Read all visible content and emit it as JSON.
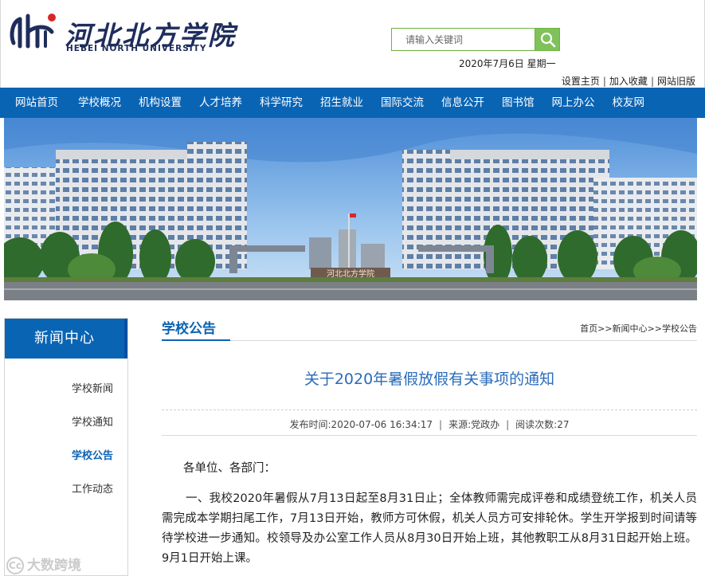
{
  "header": {
    "logo_cn": "河北北方学院",
    "logo_en": "HEBEI NORTH UNIVERSITY",
    "search": {
      "placeholder": "请输入关键词"
    },
    "date": "2020年7月6日 星期一",
    "top_links": [
      "设置主页",
      "加入收藏",
      "网站旧版"
    ]
  },
  "nav": {
    "items": [
      "网站首页",
      "学校概况",
      "机构设置",
      "人才培养",
      "科学研究",
      "招生就业",
      "国际交流",
      "信息公开",
      "图书馆",
      "网上办公",
      "校友网"
    ]
  },
  "banner": {
    "gate_text": "河北北方学院"
  },
  "sidebar": {
    "title": "新闻中心",
    "items": [
      {
        "label": "学校新闻",
        "active": false
      },
      {
        "label": "学校通知",
        "active": false
      },
      {
        "label": "学校公告",
        "active": true
      },
      {
        "label": "工作动态",
        "active": false
      }
    ]
  },
  "main": {
    "section_title": "学校公告",
    "breadcrumb": [
      "首页",
      "新闻中心",
      "学校公告"
    ],
    "breadcrumb_sep": ">>",
    "article_title": "关于2020年暑假放假有关事项的通知",
    "meta": {
      "publish_time": "发布时间:2020-07-06 16:34:17",
      "source": "来源:党政办",
      "views": "阅读次数:27"
    },
    "greeting": "各单位、各部门：",
    "paragraph": "一、我校2020年暑假从7月13日起至8月31日止；全体教师需完成评卷和成绩登统工作，机关人员需完成本学期扫尾工作，7月13日开始，教师方可休假，机关人员方可安排轮休。学生开学报到时间请等待学校进一步通知。校领导及办公室工作人员从8月30日开始上班，其他教职工从8月31日起开始上班。9月1日开始上课。"
  },
  "watermark": {
    "logo": "Cc",
    "text": "大数跨境"
  },
  "colors": {
    "brand_blue": "#0a64b4",
    "link_blue": "#2a6cba",
    "search_green": "#7fc25a"
  }
}
